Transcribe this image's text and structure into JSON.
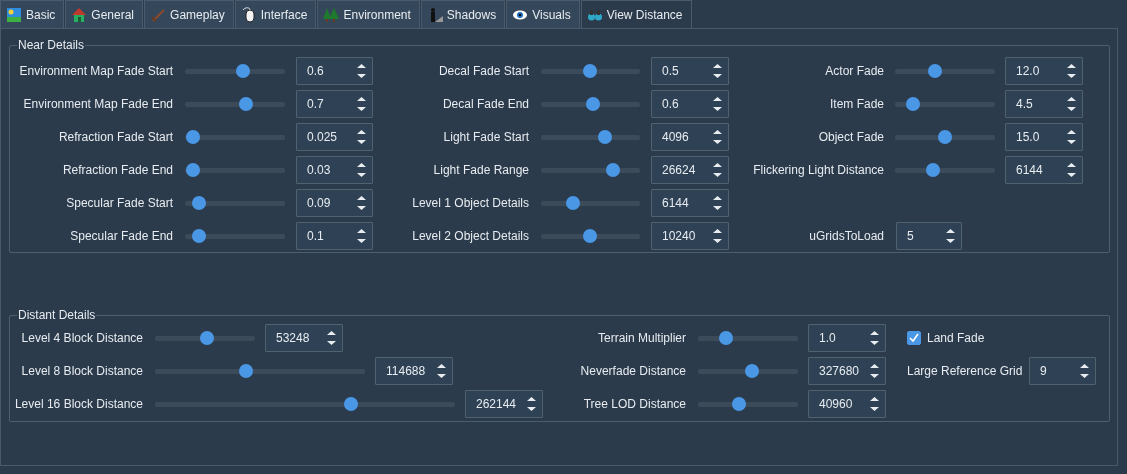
{
  "tabs": [
    {
      "label": "Basic",
      "selected": false
    },
    {
      "label": "General",
      "selected": false
    },
    {
      "label": "Gameplay",
      "selected": false
    },
    {
      "label": "Interface",
      "selected": false
    },
    {
      "label": "Environment",
      "selected": false
    },
    {
      "label": "Shadows",
      "selected": false
    },
    {
      "label": "Visuals",
      "selected": false
    },
    {
      "label": "View Distance",
      "selected": true
    }
  ],
  "groups": [
    {
      "title": "Near Details",
      "columns": [
        [
          {
            "kind": "slider",
            "label": "Environment Map Fade Start",
            "level": 0.59,
            "value": "0.6"
          },
          {
            "kind": "slider",
            "label": "Environment Map Fade End",
            "level": 0.63,
            "value": "0.7"
          },
          {
            "kind": "slider",
            "label": "Refraction Fade Start",
            "level": 0.01,
            "value": "0.025"
          },
          {
            "kind": "slider",
            "label": "Refraction Fade End",
            "level": 0.01,
            "value": "0.03"
          },
          {
            "kind": "slider",
            "label": "Specular Fade Start",
            "level": 0.08,
            "value": "0.09"
          },
          {
            "kind": "slider",
            "label": "Specular Fade End",
            "level": 0.08,
            "value": "0.1"
          }
        ],
        [
          {
            "kind": "slider",
            "label": "Decal Fade Start",
            "level": 0.49,
            "value": "0.5"
          },
          {
            "kind": "slider",
            "label": "Decal Fade End",
            "level": 0.53,
            "value": "0.6"
          },
          {
            "kind": "slider",
            "label": "Light Fade Start",
            "level": 0.67,
            "value": "4096"
          },
          {
            "kind": "slider",
            "label": "Light Fade Range",
            "level": 0.76,
            "value": "26624"
          },
          {
            "kind": "slider",
            "label": "Level 1 Object Details",
            "level": 0.29,
            "value": "6144"
          },
          {
            "kind": "slider",
            "label": "Level 2 Object Details",
            "level": 0.49,
            "value": "10240"
          }
        ],
        [
          {
            "kind": "slider",
            "label": "Actor Fade",
            "level": 0.38,
            "value": "12.0"
          },
          {
            "kind": "slider",
            "label": "Item Fade",
            "level": 0.13,
            "value": "4.5"
          },
          {
            "kind": "slider",
            "label": "Object Fade",
            "level": 0.5,
            "value": "15.0"
          },
          {
            "kind": "slider",
            "label": "Flickering Light Distance",
            "level": 0.36,
            "value": "6144"
          },
          {
            "kind": "spin",
            "label": "uGridsToLoad",
            "value": "5"
          }
        ]
      ]
    },
    {
      "title": "Distant Details",
      "columns": [
        [
          {
            "kind": "slider",
            "label": "Level 4 Block Distance",
            "level": 0.52,
            "value": "53248"
          },
          {
            "kind": "slider",
            "label": "Level 8 Block Distance",
            "level": 0.43,
            "value": "114688"
          },
          {
            "kind": "slider",
            "label": "Level 16 Block Distance",
            "level": 0.66,
            "value": "262144"
          }
        ],
        [
          {
            "kind": "slider",
            "label": "Terrain Multiplier",
            "level": 0.24,
            "value": "1.0"
          },
          {
            "kind": "slider",
            "label": "Neverfade Distance",
            "level": 0.55,
            "value": "327680"
          },
          {
            "kind": "slider",
            "label": "Tree LOD Distance",
            "level": 0.4,
            "value": "40960"
          }
        ],
        [
          {
            "kind": "checkbox",
            "label": "Land Fade",
            "checked": true
          },
          {
            "kind": "spin",
            "label": "Large Reference Grid",
            "value": "9"
          }
        ]
      ]
    }
  ]
}
